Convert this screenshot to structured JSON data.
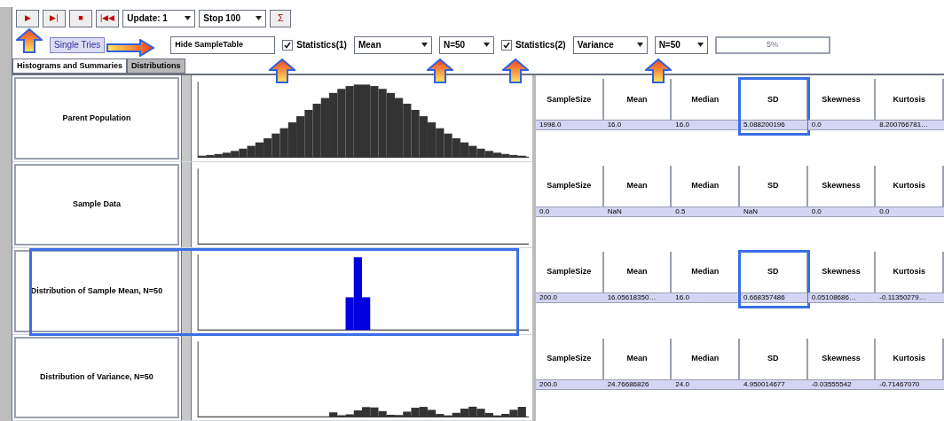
{
  "toolbar": {
    "buttons": [
      {
        "label": "▶"
      },
      {
        "label": "▶|"
      },
      {
        "label": "■"
      },
      {
        "label": "|◀◀"
      }
    ],
    "dropdowns": [
      {
        "value": "Update: 1"
      },
      {
        "value": "Stop 100"
      }
    ],
    "extra_button": "Σ"
  },
  "options": {
    "mode_button": "Single Tries",
    "table_field": "Hide SampleTable",
    "stat1": {
      "label": "Statistics(1)",
      "checked": true,
      "statistic": "Mean",
      "size": "N=50"
    },
    "stat2": {
      "label": "Statistics(2)",
      "checked": true,
      "statistic": "Variance",
      "size": "N=50"
    },
    "progress_field": "5%"
  },
  "tabs": [
    {
      "label": "Histograms and Summaries",
      "selected": true
    },
    {
      "label": "Distributions",
      "selected": false
    }
  ],
  "rows": [
    {
      "label": "Parent Population",
      "kind": "bell",
      "color": "#333333",
      "highlighted": false
    },
    {
      "label": "Sample Data",
      "kind": "empty",
      "highlighted": false
    },
    {
      "label": "Distribution of Sample Mean, N=50",
      "kind": "spike",
      "color": "#0000e0",
      "highlighted": true
    },
    {
      "label": "Distribution of Variance, N=50",
      "kind": "low",
      "color": "#333333",
      "highlighted": false
    }
  ],
  "tables": [
    {
      "columns": [
        {
          "label": "SampleSize",
          "highlighted": false
        },
        {
          "label": "Mean",
          "highlighted": false
        },
        {
          "label": "Median",
          "highlighted": false
        },
        {
          "label": "SD",
          "highlighted": true
        },
        {
          "label": "Skewness",
          "highlighted": false
        },
        {
          "label": "Kurtosis",
          "highlighted": false
        }
      ],
      "values": [
        "1998.0",
        "16.0",
        "16.0",
        "5.088200196",
        "0.0",
        "8.200766781…"
      ]
    },
    {
      "columns": [
        {
          "label": "SampleSize",
          "highlighted": false
        },
        {
          "label": "Mean",
          "highlighted": false
        },
        {
          "label": "Median",
          "highlighted": false
        },
        {
          "label": "SD",
          "highlighted": false
        },
        {
          "label": "Skewness",
          "highlighted": false
        },
        {
          "label": "Kurtosis",
          "highlighted": false
        }
      ],
      "values": [
        "0.0",
        "NaN",
        "0.5",
        "NaN",
        "0.0",
        "0.0"
      ]
    },
    {
      "columns": [
        {
          "label": "SampleSize",
          "highlighted": false
        },
        {
          "label": "Mean",
          "highlighted": false
        },
        {
          "label": "Median",
          "highlighted": false
        },
        {
          "label": "SD",
          "highlighted": true
        },
        {
          "label": "Skewness",
          "highlighted": false
        },
        {
          "label": "Kurtosis",
          "highlighted": false
        }
      ],
      "values": [
        "200.0",
        "16.05618350…",
        "16.0",
        "0.668357486",
        "0.05108686…",
        "-0.11350279…"
      ]
    },
    {
      "columns": [
        {
          "label": "SampleSize",
          "highlighted": false
        },
        {
          "label": "Mean",
          "highlighted": false
        },
        {
          "label": "Median",
          "highlighted": false
        },
        {
          "label": "SD",
          "highlighted": false
        },
        {
          "label": "Skewness",
          "highlighted": false
        },
        {
          "label": "Kurtosis",
          "highlighted": false
        }
      ],
      "values": [
        "200.0",
        "24.76686826",
        "24.0",
        "4.950014677",
        "-0.03555542",
        "-0.71467070"
      ]
    }
  ]
}
